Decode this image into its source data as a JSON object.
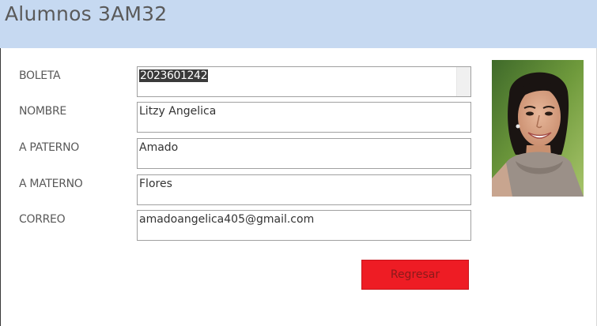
{
  "header": {
    "title": "Alumnos 3AM32"
  },
  "form": {
    "fields": [
      {
        "label": "BOLETA",
        "value": "2023601242"
      },
      {
        "label": "NOMBRE",
        "value": "Litzy Angelica"
      },
      {
        "label": "A PATERNO",
        "value": "Amado"
      },
      {
        "label": "A MATERNO",
        "value": "Flores"
      },
      {
        "label": "CORREO",
        "value": "amadoangelica405@gmail.com"
      }
    ]
  },
  "actions": {
    "back_label": "Regresar"
  },
  "colors": {
    "header_bg": "#c6d9f1",
    "button_bg": "#ee1c24"
  }
}
